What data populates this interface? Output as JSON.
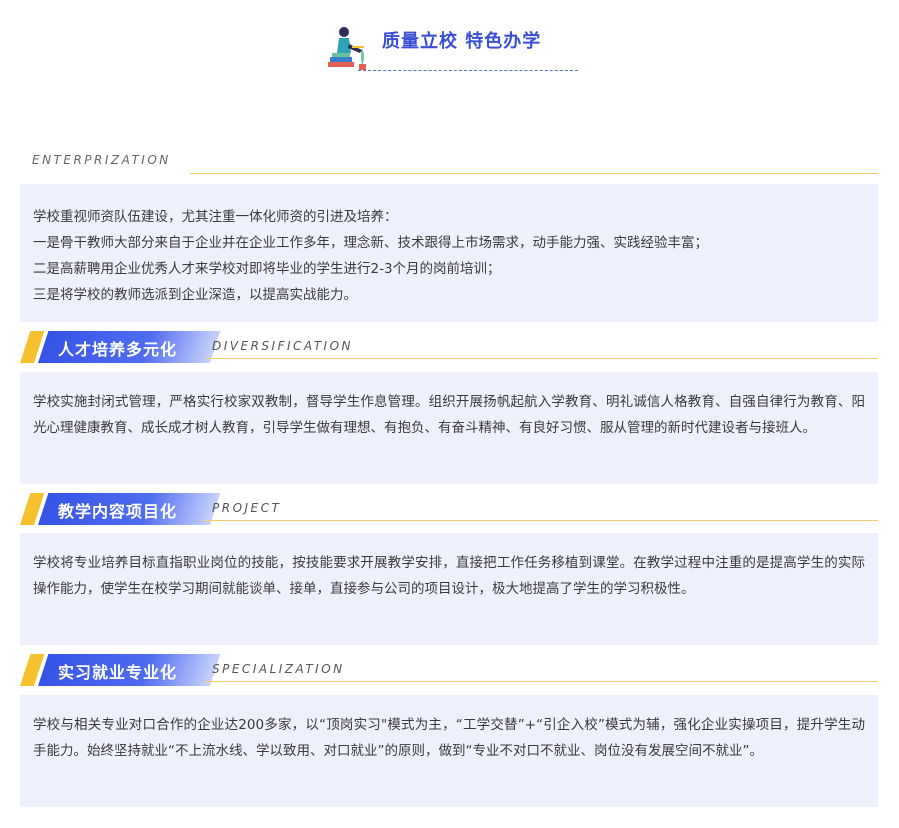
{
  "header": {
    "title": "质量立校  特色办学"
  },
  "sections": [
    {
      "en": "ENTERPRIZATION",
      "lines": [
        "学校重视师资队伍建设，尤其注重一体化师资的引进及培养：",
        "一是骨干教师大部分来自于企业并在企业工作多年，理念新、技术跟得上市场需求，动手能力强、实践经验丰富；",
        "二是高薪聘用企业优秀人才来学校对即将毕业的学生进行2-3个月的岗前培训；",
        "三是将学校的教师选派到企业深造，以提高实战能力。"
      ]
    },
    {
      "title": "人才培养多元化",
      "en": "DIVERSIFICATION",
      "text": "学校实施封闭式管理，严格实行校家双教制，督导学生作息管理。组织开展扬帆起航入学教育、明礼诚信人格教育、自强自律行为教育、阳光心理健康教育、成长成才树人教育，引导学生做有理想、有抱负、有奋斗精神、有良好习惯、服从管理的新时代建设者与接班人。"
    },
    {
      "title": "教学内容项目化",
      "en": "PROJECT",
      "text": "学校将专业培养目标直指职业岗位的技能，按技能要求开展教学安排，直接把工作任务移植到课堂。在教学过程中注重的是提高学生的实际操作能力，使学生在校学习期间就能谈单、接单，直接参与公司的项目设计，极大地提高了学生的学习积极性。"
    },
    {
      "title": "实习就业专业化",
      "en": "SPECIALIZATION",
      "text": "学校与相关专业对口合作的企业达200多家，以“顶岗实习\"模式为主，“工学交替”+“引企入校”模式为辅，强化企业实操项目，提升学生动手能力。始终坚持就业“不上流水线、学以致用、对口就业”的原则，做到“专业不对口不就业、岗位没有发展空间不就业”。"
    }
  ],
  "colors": {
    "accent_blue": "#3554e6",
    "accent_gold": "#f5c12e",
    "box_bg": "#eef0fb",
    "title_blue": "#3a4fd6"
  }
}
